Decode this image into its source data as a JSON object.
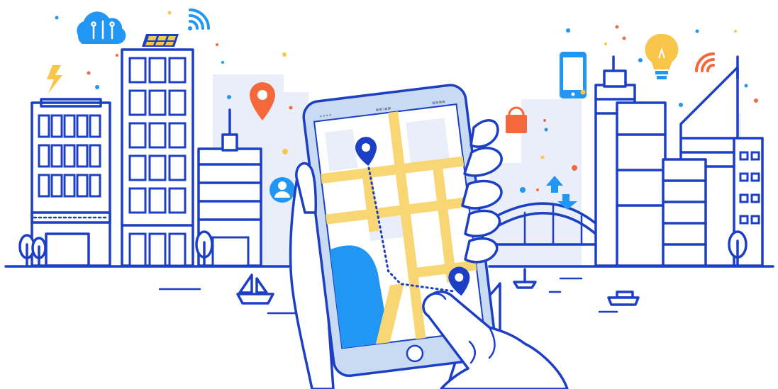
{
  "scene": {
    "colors": {
      "outline": "#1c3fc4",
      "accent_blue": "#2196f3",
      "accent_orange": "#f4683c",
      "accent_yellow": "#f7c64a",
      "road": "#f7d673",
      "water": "#2196f3",
      "background_blocks": "#e9eef9"
    },
    "icons": [
      "cloud-network-icon",
      "wifi-icon",
      "solar-panel-icon",
      "lightning-icon",
      "location-pin-icon",
      "user-profile-icon",
      "shopping-bag-icon",
      "smartphone-icon",
      "lightbulb-icon",
      "signal-icon",
      "sync-arrows-icon",
      "sailboat-icon",
      "ferry-icon"
    ],
    "phone": {
      "status_left": "••••",
      "status_center": "▪▪:▪▪",
      "status_right": "▪▪▪▪"
    }
  }
}
